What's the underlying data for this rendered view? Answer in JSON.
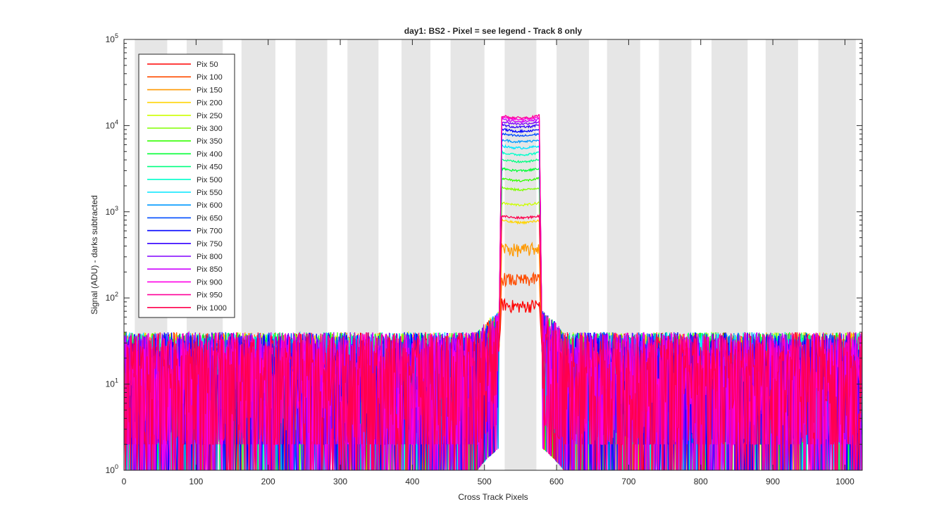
{
  "chart_data": {
    "type": "line",
    "title": "day1: BS2 - Pixel = see legend - Track 8 only",
    "xlabel": "Cross Track Pixels",
    "ylabel": "Signal (ADU) - darks subtracted",
    "xlim": [
      0,
      1024
    ],
    "ylim": [
      1,
      100000
    ],
    "yscale": "log",
    "grid": false,
    "legend_position": "top-left",
    "x_ticks": [
      "0",
      "100",
      "200",
      "300",
      "400",
      "500",
      "600",
      "700",
      "800",
      "900",
      "1000"
    ],
    "y_ticks": [
      {
        "base": "10",
        "exp": "0"
      },
      {
        "base": "10",
        "exp": "1"
      },
      {
        "base": "10",
        "exp": "2"
      },
      {
        "base": "10",
        "exp": "3"
      },
      {
        "base": "10",
        "exp": "4"
      },
      {
        "base": "10",
        "exp": "5"
      }
    ],
    "shaded_bands_x": [
      [
        15,
        60
      ],
      [
        87,
        137
      ],
      [
        163,
        210
      ],
      [
        238,
        282
      ],
      [
        310,
        353
      ],
      [
        385,
        425
      ],
      [
        453,
        500
      ],
      [
        528,
        572
      ],
      [
        600,
        645
      ],
      [
        670,
        716
      ],
      [
        742,
        787
      ],
      [
        815,
        865
      ],
      [
        890,
        935
      ],
      [
        963,
        1015
      ]
    ],
    "band_color": "#e6e6e6",
    "background_level": 12,
    "plateau_x": [
      520,
      580
    ],
    "series": [
      {
        "name": "Pix 50",
        "color": "#ff0000",
        "plateau": 80
      },
      {
        "name": "Pix 100",
        "color": "#ff4d00",
        "plateau": 160
      },
      {
        "name": "Pix 150",
        "color": "#ff9900",
        "plateau": 360
      },
      {
        "name": "Pix 200",
        "color": "#ffd400",
        "plateau": 750
      },
      {
        "name": "Pix 250",
        "color": "#ccff00",
        "plateau": 1200
      },
      {
        "name": "Pix 300",
        "color": "#80ff00",
        "plateau": 1800
      },
      {
        "name": "Pix 350",
        "color": "#33ff00",
        "plateau": 2300
      },
      {
        "name": "Pix 400",
        "color": "#00ff33",
        "plateau": 3000
      },
      {
        "name": "Pix 450",
        "color": "#00ff80",
        "plateau": 3800
      },
      {
        "name": "Pix 500",
        "color": "#00ffcc",
        "plateau": 4600
      },
      {
        "name": "Pix 550",
        "color": "#00e6ff",
        "plateau": 5500
      },
      {
        "name": "Pix 600",
        "color": "#0099ff",
        "plateau": 6500
      },
      {
        "name": "Pix 650",
        "color": "#004dff",
        "plateau": 7600
      },
      {
        "name": "Pix 700",
        "color": "#0000ff",
        "plateau": 8600
      },
      {
        "name": "Pix 750",
        "color": "#3300ff",
        "plateau": 9600
      },
      {
        "name": "Pix 800",
        "color": "#8000ff",
        "plateau": 10500
      },
      {
        "name": "Pix 850",
        "color": "#cc00ff",
        "plateau": 11200
      },
      {
        "name": "Pix 900",
        "color": "#ff00e6",
        "plateau": 11800
      },
      {
        "name": "Pix 950",
        "color": "#ff0099",
        "plateau": 12300
      },
      {
        "name": "Pix 1000",
        "color": "#ff004d",
        "plateau": 850
      }
    ]
  }
}
